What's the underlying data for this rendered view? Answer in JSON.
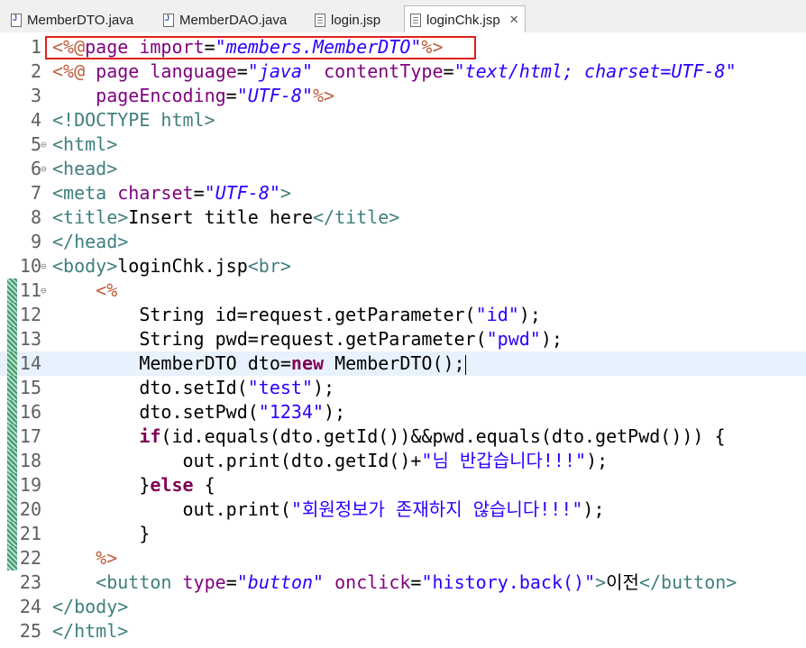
{
  "tabs": [
    {
      "label": "MemberDTO.java",
      "icon": "java-file-icon"
    },
    {
      "label": "MemberDAO.java",
      "icon": "java-file-icon"
    },
    {
      "label": "login.jsp",
      "icon": "jsp-file-icon"
    },
    {
      "label": "loginChk.jsp",
      "icon": "jsp-file-icon",
      "active": true
    }
  ],
  "close_glyph": "✕",
  "lines": [
    {
      "n": "1",
      "t": [
        [
          "jsp",
          "<%@"
        ],
        [
          "attr",
          "page"
        ],
        [
          "txt",
          " "
        ],
        [
          "attr",
          "import"
        ],
        [
          "txt",
          "="
        ],
        [
          "val",
          "\"members.MemberDTO\""
        ],
        [
          "jsp",
          "%>"
        ]
      ]
    },
    {
      "n": "2",
      "t": [
        [
          "jsp",
          "<%@"
        ],
        [
          "txt",
          " "
        ],
        [
          "attr",
          "page"
        ],
        [
          "txt",
          " "
        ],
        [
          "attr",
          "language"
        ],
        [
          "txt",
          "="
        ],
        [
          "val",
          "\"java\""
        ],
        [
          "txt",
          " "
        ],
        [
          "attr",
          "contentType"
        ],
        [
          "txt",
          "="
        ],
        [
          "val",
          "\"text/html; charset=UTF-8\""
        ]
      ]
    },
    {
      "n": "3",
      "t": [
        [
          "txt",
          "    "
        ],
        [
          "attr",
          "pageEncoding"
        ],
        [
          "txt",
          "="
        ],
        [
          "val",
          "\"UTF-8\""
        ],
        [
          "jsp",
          "%>"
        ]
      ]
    },
    {
      "n": "4",
      "t": [
        [
          "tag",
          "<!DOCTYPE html>"
        ]
      ]
    },
    {
      "n": "5",
      "fold": true,
      "t": [
        [
          "tag",
          "<html>"
        ]
      ]
    },
    {
      "n": "6",
      "fold": true,
      "t": [
        [
          "tag",
          "<head>"
        ]
      ]
    },
    {
      "n": "7",
      "t": [
        [
          "tag",
          "<meta"
        ],
        [
          "txt",
          " "
        ],
        [
          "attr",
          "charset"
        ],
        [
          "txt",
          "="
        ],
        [
          "val",
          "\"UTF-8\""
        ],
        [
          "tag",
          ">"
        ]
      ]
    },
    {
      "n": "8",
      "t": [
        [
          "tag",
          "<title>"
        ],
        [
          "txt",
          "Insert title here"
        ],
        [
          "tag",
          "</title>"
        ]
      ]
    },
    {
      "n": "9",
      "t": [
        [
          "tag",
          "</head>"
        ]
      ]
    },
    {
      "n": "10",
      "fold": true,
      "t": [
        [
          "tag",
          "<body>"
        ],
        [
          "txt",
          "loginChk.jsp"
        ],
        [
          "tag",
          "<br>"
        ]
      ]
    },
    {
      "n": "11",
      "fold": true,
      "changed": true,
      "t": [
        [
          "txt",
          "    "
        ],
        [
          "jsp",
          "<%"
        ]
      ]
    },
    {
      "n": "12",
      "changed": true,
      "t": [
        [
          "txt",
          "        String id=request.getParameter("
        ],
        [
          "str",
          "\"id\""
        ],
        [
          "txt",
          ");"
        ]
      ]
    },
    {
      "n": "13",
      "changed": true,
      "t": [
        [
          "txt",
          "        String pwd=request.getParameter("
        ],
        [
          "str",
          "\"pwd\""
        ],
        [
          "txt",
          ");"
        ]
      ]
    },
    {
      "n": "14",
      "changed": true,
      "current": true,
      "t": [
        [
          "txt",
          "        MemberDTO dto="
        ],
        [
          "kw",
          "new"
        ],
        [
          "txt",
          " MemberDTO();"
        ]
      ]
    },
    {
      "n": "15",
      "changed": true,
      "t": [
        [
          "txt",
          "        dto.setId("
        ],
        [
          "str",
          "\"test\""
        ],
        [
          "txt",
          ");"
        ]
      ]
    },
    {
      "n": "16",
      "changed": true,
      "t": [
        [
          "txt",
          "        dto.setPwd("
        ],
        [
          "str",
          "\"1234\""
        ],
        [
          "txt",
          ");"
        ]
      ]
    },
    {
      "n": "17",
      "changed": true,
      "t": [
        [
          "txt",
          "        "
        ],
        [
          "kw",
          "if"
        ],
        [
          "txt",
          "(id.equals(dto.getId())&&pwd.equals(dto.getPwd())) {"
        ]
      ]
    },
    {
      "n": "18",
      "changed": true,
      "t": [
        [
          "txt",
          "            out.print(dto.getId()+"
        ],
        [
          "str",
          "\"님 반갑습니다!!!\""
        ],
        [
          "txt",
          ");"
        ]
      ]
    },
    {
      "n": "19",
      "changed": true,
      "t": [
        [
          "txt",
          "        }"
        ],
        [
          "kw",
          "else"
        ],
        [
          "txt",
          " {"
        ]
      ]
    },
    {
      "n": "20",
      "changed": true,
      "t": [
        [
          "txt",
          "            out.print("
        ],
        [
          "str",
          "\"회원정보가 존재하지 않습니다!!!\""
        ],
        [
          "txt",
          ");"
        ]
      ]
    },
    {
      "n": "21",
      "changed": true,
      "t": [
        [
          "txt",
          "        }"
        ]
      ]
    },
    {
      "n": "22",
      "changed": true,
      "t": [
        [
          "txt",
          "    "
        ],
        [
          "jsp",
          "%>"
        ]
      ]
    },
    {
      "n": "23",
      "t": [
        [
          "txt",
          "    "
        ],
        [
          "tag",
          "<button"
        ],
        [
          "txt",
          " "
        ],
        [
          "attr",
          "type"
        ],
        [
          "txt",
          "="
        ],
        [
          "val",
          "\"button\""
        ],
        [
          "txt",
          " "
        ],
        [
          "attr",
          "onclick"
        ],
        [
          "txt",
          "="
        ],
        [
          "str",
          "\"history.back()\""
        ],
        [
          "tag",
          ">"
        ],
        [
          "txt",
          "이전"
        ],
        [
          "tag",
          "</button>"
        ]
      ]
    },
    {
      "n": "24",
      "t": [
        [
          "tag",
          "</body>"
        ]
      ]
    },
    {
      "n": "25",
      "t": [
        [
          "tag",
          "</html>"
        ]
      ]
    }
  ]
}
